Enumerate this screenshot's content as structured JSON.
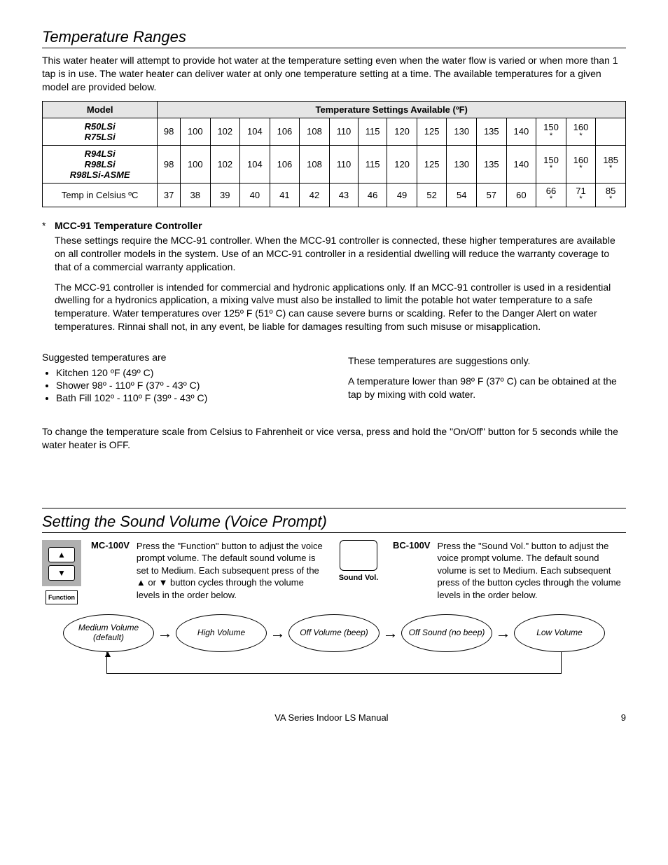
{
  "section1": {
    "heading": "Temperature Ranges",
    "intro": "This water heater will attempt to provide hot water at the temperature setting even when the water flow is varied or when more than 1 tap is in use.  The water heater can deliver water at only one temperature setting at a time.  The available temperatures for a given model are provided below.",
    "table": {
      "h_model": "Model",
      "h_temps": "Temperature Settings Available (ºF)",
      "row1_label_a": "R50LSi",
      "row1_label_b": "R75LSi",
      "row2_label_a": "R94LSi",
      "row2_label_b": "R98LSi",
      "row2_label_c": "R98LSi-ASME",
      "row3_label": "Temp in Celsius  ºC",
      "r1": [
        "98",
        "100",
        "102",
        "104",
        "106",
        "108",
        "110",
        "115",
        "120",
        "125",
        "130",
        "135",
        "140",
        "150",
        "160",
        ""
      ],
      "r1_star": [
        false,
        false,
        false,
        false,
        false,
        false,
        false,
        false,
        false,
        false,
        false,
        false,
        false,
        true,
        true,
        false
      ],
      "r2": [
        "98",
        "100",
        "102",
        "104",
        "106",
        "108",
        "110",
        "115",
        "120",
        "125",
        "130",
        "135",
        "140",
        "150",
        "160",
        "185"
      ],
      "r2_star": [
        false,
        false,
        false,
        false,
        false,
        false,
        false,
        false,
        false,
        false,
        false,
        false,
        false,
        true,
        true,
        true
      ],
      "r3": [
        "37",
        "38",
        "39",
        "40",
        "41",
        "42",
        "43",
        "46",
        "49",
        "52",
        "54",
        "57",
        "60",
        "66",
        "71",
        "85"
      ],
      "r3_star": [
        false,
        false,
        false,
        false,
        false,
        false,
        false,
        false,
        false,
        false,
        false,
        false,
        false,
        true,
        true,
        true
      ]
    },
    "note_marker": "*",
    "note_title": "MCC-91 Temperature Controller",
    "note_p1": "These settings require the MCC-91 controller.  When the MCC-91 controller is connected, these higher temperatures are available on all controller models in the system. Use of an MCC-91 controller in a residential dwelling will reduce the warranty coverage to that of a commercial warranty application.",
    "note_p2": "The MCC-91 controller is intended for commercial and hydronic applications only. If an MCC-91 controller is used in a residential dwelling for a hydronics application, a mixing valve must also be installed to limit the potable hot water temperature to a safe temperature. Water temperatures over 125º F (51º C) can cause severe burns or scalding. Refer to the Danger Alert on water temperatures. Rinnai shall not, in any event, be liable for damages resulting from such misuse or misapplication.",
    "suggest_intro": "Suggested temperatures are",
    "suggest": [
      "Kitchen     120 ºF (49º C)",
      "Shower    98º - 110º F (37º - 43º C)",
      "Bath Fill   102º - 110º F (39º - 43º C)"
    ],
    "right_p1": "These temperatures are suggestions only.",
    "right_p2": "A temperature lower than 98º F (37º C) can be obtained at the tap by mixing with cold water.",
    "scale_change": "To change the temperature scale from Celsius to Fahrenheit or vice versa, press and hold the \"On/Off\" button for 5 seconds while the water heater is OFF."
  },
  "section2": {
    "heading": "Setting the Sound Volume (Voice Prompt)",
    "mc_label": "MC-100V",
    "mc_text": "Press the \"Function\" button to adjust the voice prompt volume.  The default sound volume is set to Medium. Each subsequent press of the ▲ or ▼ button cycles through the volume levels in the order below.",
    "up": "▲",
    "down": "▼",
    "function": "Function",
    "sv_label": "Sound Vol.",
    "bc_label": "BC-100V",
    "bc_text": "Press the \"Sound Vol.\" button to adjust the voice prompt volume. The default sound volume is set to Medium.  Each subsequent press of the button cycles through the volume levels in the order below.",
    "flow": [
      "Medium Volume (default)",
      "High Volume",
      "Off Volume (beep)",
      "Off Sound (no beep)",
      "Low Volume"
    ]
  },
  "footer": {
    "center": "VA Series Indoor LS Manual",
    "page": "9"
  }
}
